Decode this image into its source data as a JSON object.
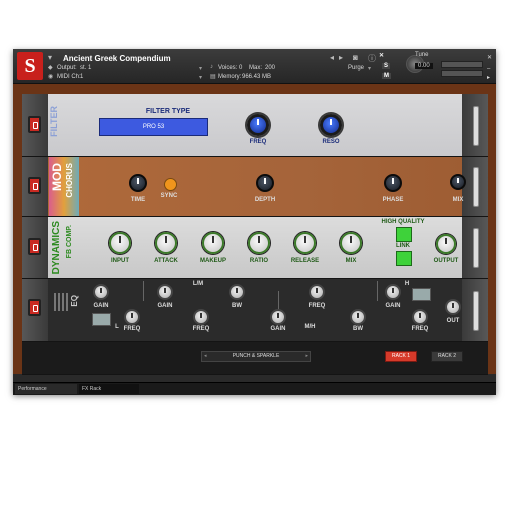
{
  "header": {
    "instrument_name": "Ancient Greek Compendium",
    "output_label": "Output:",
    "output_value": "st. 1",
    "midi_label": "MIDI Ch:",
    "midi_value": "1",
    "voices_label": "Voices:",
    "voices_value": "0",
    "max_label": "Max:",
    "max_value": "200",
    "memory_label": "Memory:",
    "memory_value": "966.43 MB",
    "purge_label": "Purge",
    "tune_label": "Tune",
    "tune_value": "0.00",
    "logo_letter": "S",
    "mute_label": "M",
    "solo_label": "S"
  },
  "filter": {
    "title": "FILTER",
    "type_label": "FILTER TYPE",
    "type_value": "PRO 53",
    "freq_label": "FREQ",
    "reso_label": "RESO"
  },
  "chorus": {
    "title_mod": "MOD",
    "title_chorus": "CHORUS",
    "time_label": "TIME",
    "sync_label": "SYNC",
    "depth_label": "DEPTH",
    "phase_label": "PHASE",
    "mix_label": "MIX"
  },
  "dynamics": {
    "title": "DYNAMICS",
    "subtitle": "FB COMP.",
    "input_label": "INPUT",
    "attack_label": "ATTACK",
    "makeup_label": "MAKEUP",
    "ratio_label": "RATIO",
    "release_label": "RELEASE",
    "mix_label": "MIX",
    "high_quality_label": "HIGH QUALITY",
    "link_label": "LINK",
    "output_label": "OUTPUT"
  },
  "eq": {
    "title": "EQ",
    "gain_label": "GAIN",
    "freq_label": "FREQ",
    "bw_label": "BW",
    "l_label": "L",
    "lm_label": "L/M",
    "mh_label": "M/H",
    "h_label": "H",
    "out_label": "OUT"
  },
  "footer": {
    "preset_name": "PUNCH & SPARKLE",
    "rack1_label": "RACK 1",
    "rack2_label": "RACK 2"
  },
  "status_tabs": [
    "Performance",
    "FX Rack"
  ],
  "colors": {
    "accent_red": "#c92a22",
    "knob_blue": "#2b54e6",
    "filter_panel": "#d4d4d6",
    "chorus_panel": "#a4643c",
    "dynamics_panel": "#d6d6d6",
    "eq_panel": "#2a2a2a"
  }
}
